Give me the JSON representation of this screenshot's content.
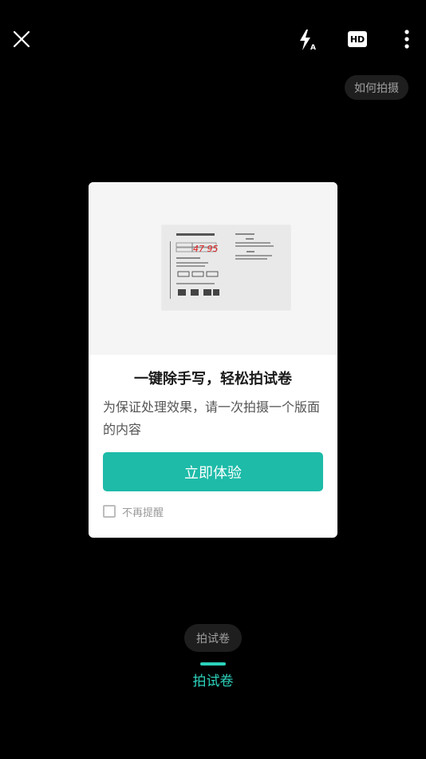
{
  "header": {
    "close_icon": "close-icon",
    "flash_icon": "flash-auto-icon",
    "hd_label": "HD",
    "more_icon": "more-vertical-icon"
  },
  "howto": {
    "label": "如何拍摄"
  },
  "dialog": {
    "title": "一键除手写，轻松拍试卷",
    "description": "为保证处理效果，请一次拍摄一个版面的内容",
    "primary_button": "立即体验",
    "dont_remind_label": "不再提醒",
    "dont_remind_checked": false,
    "preview_image": "exam-paper-preview",
    "accent_color": "#1dbba8"
  },
  "mode": {
    "pill_label": "拍试卷",
    "active_label": "拍试卷",
    "active_color": "#2cd2bc"
  }
}
